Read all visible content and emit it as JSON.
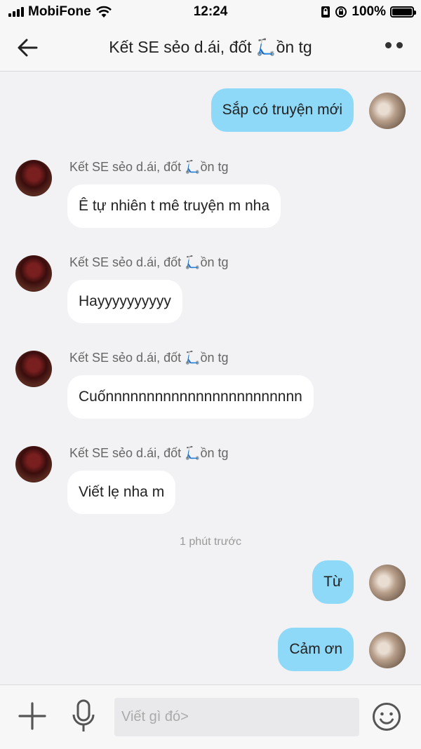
{
  "status_bar": {
    "carrier": "MobiFone",
    "time": "12:24",
    "battery": "100%"
  },
  "header": {
    "title": "Kết SE sẻo d.ái, đốt 🛴ồn tg"
  },
  "messages": [
    {
      "direction": "out",
      "text": "Sắp có truyện mới"
    },
    {
      "direction": "in",
      "sender": "Kết SE sẻo d.ái, đốt 🛴ồn tg",
      "text": "Ê tự nhiên t mê truyện m nha"
    },
    {
      "direction": "in",
      "sender": "Kết SE sẻo d.ái, đốt 🛴ồn tg",
      "text": "Hayyyyyyyyyy"
    },
    {
      "direction": "in",
      "sender": "Kết SE sẻo d.ái, đốt 🛴ồn tg",
      "text": "Cuốnnnnnnnnnnnnnnnnnnnnnnnn"
    },
    {
      "direction": "in",
      "sender": "Kết SE sẻo d.ái, đốt 🛴ồn tg",
      "text": "Viết lẹ nha m"
    },
    {
      "direction": "out",
      "text": "Từ"
    },
    {
      "direction": "out",
      "text": "Cảm ơn"
    }
  ],
  "timestamp": "1 phút trước",
  "composer": {
    "placeholder": "Viết gì đó>"
  },
  "icons": {
    "back": "arrow-left-icon",
    "more": "more-dots-icon",
    "plus": "plus-icon",
    "mic": "microphone-icon",
    "emoji": "smiley-icon"
  },
  "colors": {
    "outgoing_bubble": "#8ed8f8",
    "incoming_bubble": "#ffffff",
    "background": "#f2f2f4"
  }
}
